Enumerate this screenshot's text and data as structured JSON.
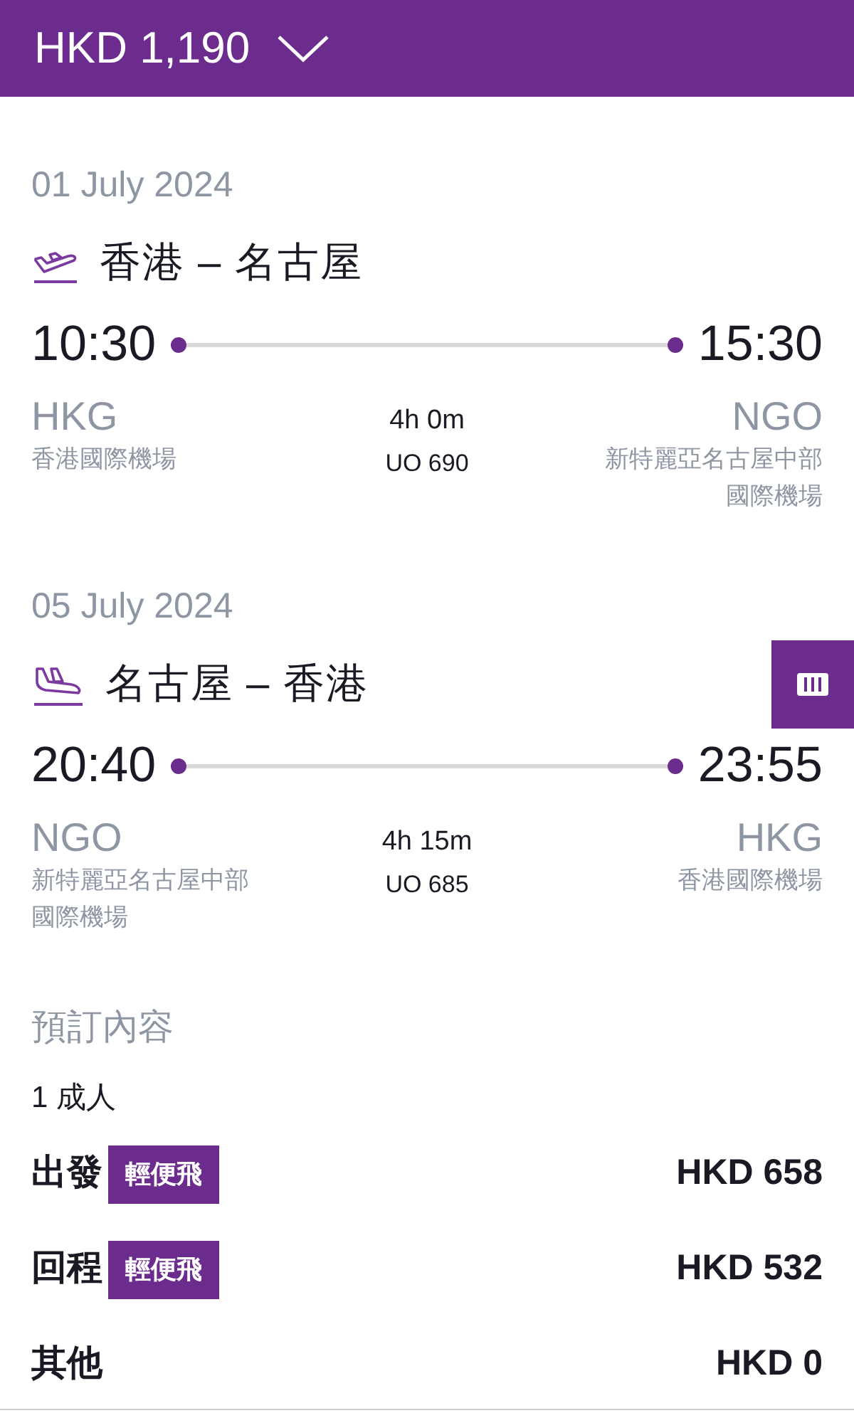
{
  "header": {
    "total": "HKD 1,190"
  },
  "flights": [
    {
      "kind": "departure",
      "date": "01 July 2024",
      "route": "香港 – 名古屋",
      "depart_time": "10:30",
      "arrive_time": "15:30",
      "from_code": "HKG",
      "from_airport": "香港國際機場",
      "duration": "4h 0m",
      "flight_number": "UO 690",
      "to_code": "NGO",
      "to_airport": "新特麗亞名古屋中部國際機場"
    },
    {
      "kind": "arrival",
      "date": "05 July 2024",
      "route": "名古屋 – 香港",
      "depart_time": "20:40",
      "arrive_time": "23:55",
      "from_code": "NGO",
      "from_airport": "新特麗亞名古屋中部國際機場",
      "duration": "4h 15m",
      "flight_number": "UO 685",
      "to_code": "HKG",
      "to_airport": "香港國際機場"
    }
  ],
  "booking": {
    "title": "預訂內容",
    "passengers": "1 成人",
    "items": [
      {
        "label": "出發",
        "fare": "輕便飛",
        "price": "HKD 658"
      },
      {
        "label": "回程",
        "fare": "輕便飛",
        "price": "HKD 532"
      },
      {
        "label": "其他",
        "price": "HKD 0"
      }
    ]
  }
}
